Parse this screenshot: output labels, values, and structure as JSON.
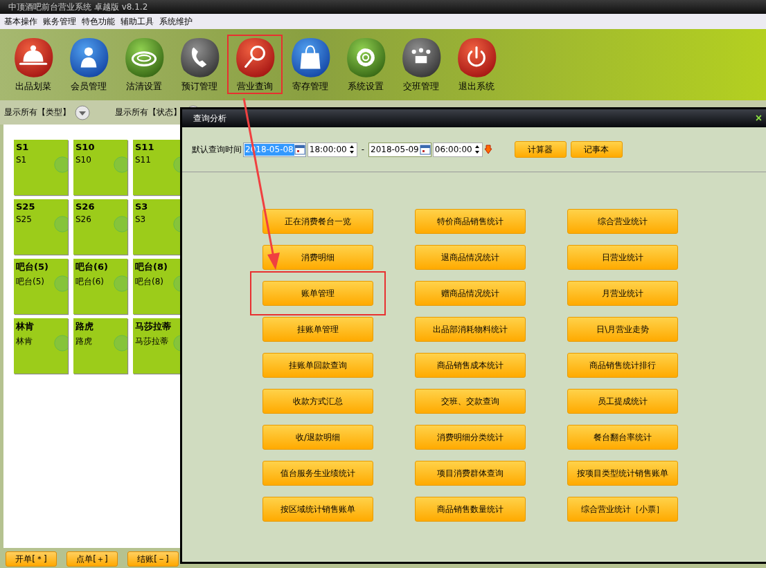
{
  "window": {
    "title": "中顶酒吧前台营业系统 卓越版 v8.1.2"
  },
  "menu": [
    "基本操作",
    "账务管理",
    "特色功能",
    "辅助工具",
    "系统维护"
  ],
  "toolbar": [
    {
      "label": "出品划菜",
      "kind": "cloche",
      "highlighted": false
    },
    {
      "label": "会员管理",
      "kind": "person",
      "highlighted": false
    },
    {
      "label": "沽清设置",
      "kind": "plate",
      "highlighted": false
    },
    {
      "label": "预订管理",
      "kind": "phone",
      "highlighted": false
    },
    {
      "label": "营业查询",
      "kind": "search",
      "highlighted": true
    },
    {
      "label": "寄存管理",
      "kind": "bag",
      "highlighted": false
    },
    {
      "label": "系统设置",
      "kind": "gear",
      "highlighted": false
    },
    {
      "label": "交班管理",
      "kind": "meeting",
      "highlighted": false
    },
    {
      "label": "退出系统",
      "kind": "power",
      "highlighted": false
    }
  ],
  "filters": [
    "显示所有【类型】",
    "显示所有【状态】"
  ],
  "tables": [
    {
      "name": "S1",
      "sub": "S1"
    },
    {
      "name": "S10",
      "sub": "S10"
    },
    {
      "name": "S11",
      "sub": "S11"
    },
    {
      "name": "S25",
      "sub": "S25"
    },
    {
      "name": "S26",
      "sub": "S26"
    },
    {
      "name": "S3",
      "sub": "S3"
    },
    {
      "name": "吧台(5)",
      "sub": "吧台(5)"
    },
    {
      "name": "吧台(6)",
      "sub": "吧台(6)"
    },
    {
      "name": "吧台(8)",
      "sub": "吧台(8)"
    },
    {
      "name": "林肯",
      "sub": "林肯"
    },
    {
      "name": "路虎",
      "sub": "路虎"
    },
    {
      "name": "马莎拉蒂",
      "sub": "马莎拉蒂"
    }
  ],
  "bottom_buttons": [
    "开单[＊]",
    "点单[＋]",
    "结账[－]"
  ],
  "dialog": {
    "title": "查询分析",
    "close": "×",
    "time_label": "默认查询时间",
    "start_date": {
      "value": "2018-05-08",
      "highlighted": true
    },
    "start_time": "18:00:00",
    "separator": "-",
    "end_date": {
      "value": "2018-05-09",
      "highlighted": false
    },
    "end_time": "06:00:00",
    "tools": [
      "计算器",
      "记事本"
    ],
    "buttons": [
      {
        "label": "正在消费餐台一览",
        "highlighted": false
      },
      {
        "label": "特价商品销售统计",
        "highlighted": false
      },
      {
        "label": "综合营业统计",
        "highlighted": false
      },
      {
        "label": "消费明细",
        "highlighted": false
      },
      {
        "label": "退商品情况统计",
        "highlighted": false
      },
      {
        "label": "日营业统计",
        "highlighted": false
      },
      {
        "label": "账单管理",
        "highlighted": true
      },
      {
        "label": "赠商品情况统计",
        "highlighted": false
      },
      {
        "label": "月营业统计",
        "highlighted": false
      },
      {
        "label": "挂账单管理",
        "highlighted": false
      },
      {
        "label": "出品部消耗物料统计",
        "highlighted": false
      },
      {
        "label": "日\\月营业走势",
        "highlighted": false
      },
      {
        "label": "挂账单回款查询",
        "highlighted": false
      },
      {
        "label": "商品销售成本统计",
        "highlighted": false
      },
      {
        "label": "商品销售统计排行",
        "highlighted": false
      },
      {
        "label": "收款方式汇总",
        "highlighted": false
      },
      {
        "label": "交班、交款查询",
        "highlighted": false
      },
      {
        "label": "员工提成统计",
        "highlighted": false
      },
      {
        "label": "收/退款明细",
        "highlighted": false
      },
      {
        "label": "消费明细分类统计",
        "highlighted": false
      },
      {
        "label": "餐台翻台率统计",
        "highlighted": false
      },
      {
        "label": "值台服务生业绩统计",
        "highlighted": false
      },
      {
        "label": "项目消费群体查询",
        "highlighted": false
      },
      {
        "label": "按项目类型统计销售账单",
        "highlighted": false
      },
      {
        "label": "按区域统计销售账单",
        "highlighted": false
      },
      {
        "label": "商品销售数量统计",
        "highlighted": false
      },
      {
        "label": "综合营业统计［小票］",
        "highlighted": false
      }
    ]
  }
}
